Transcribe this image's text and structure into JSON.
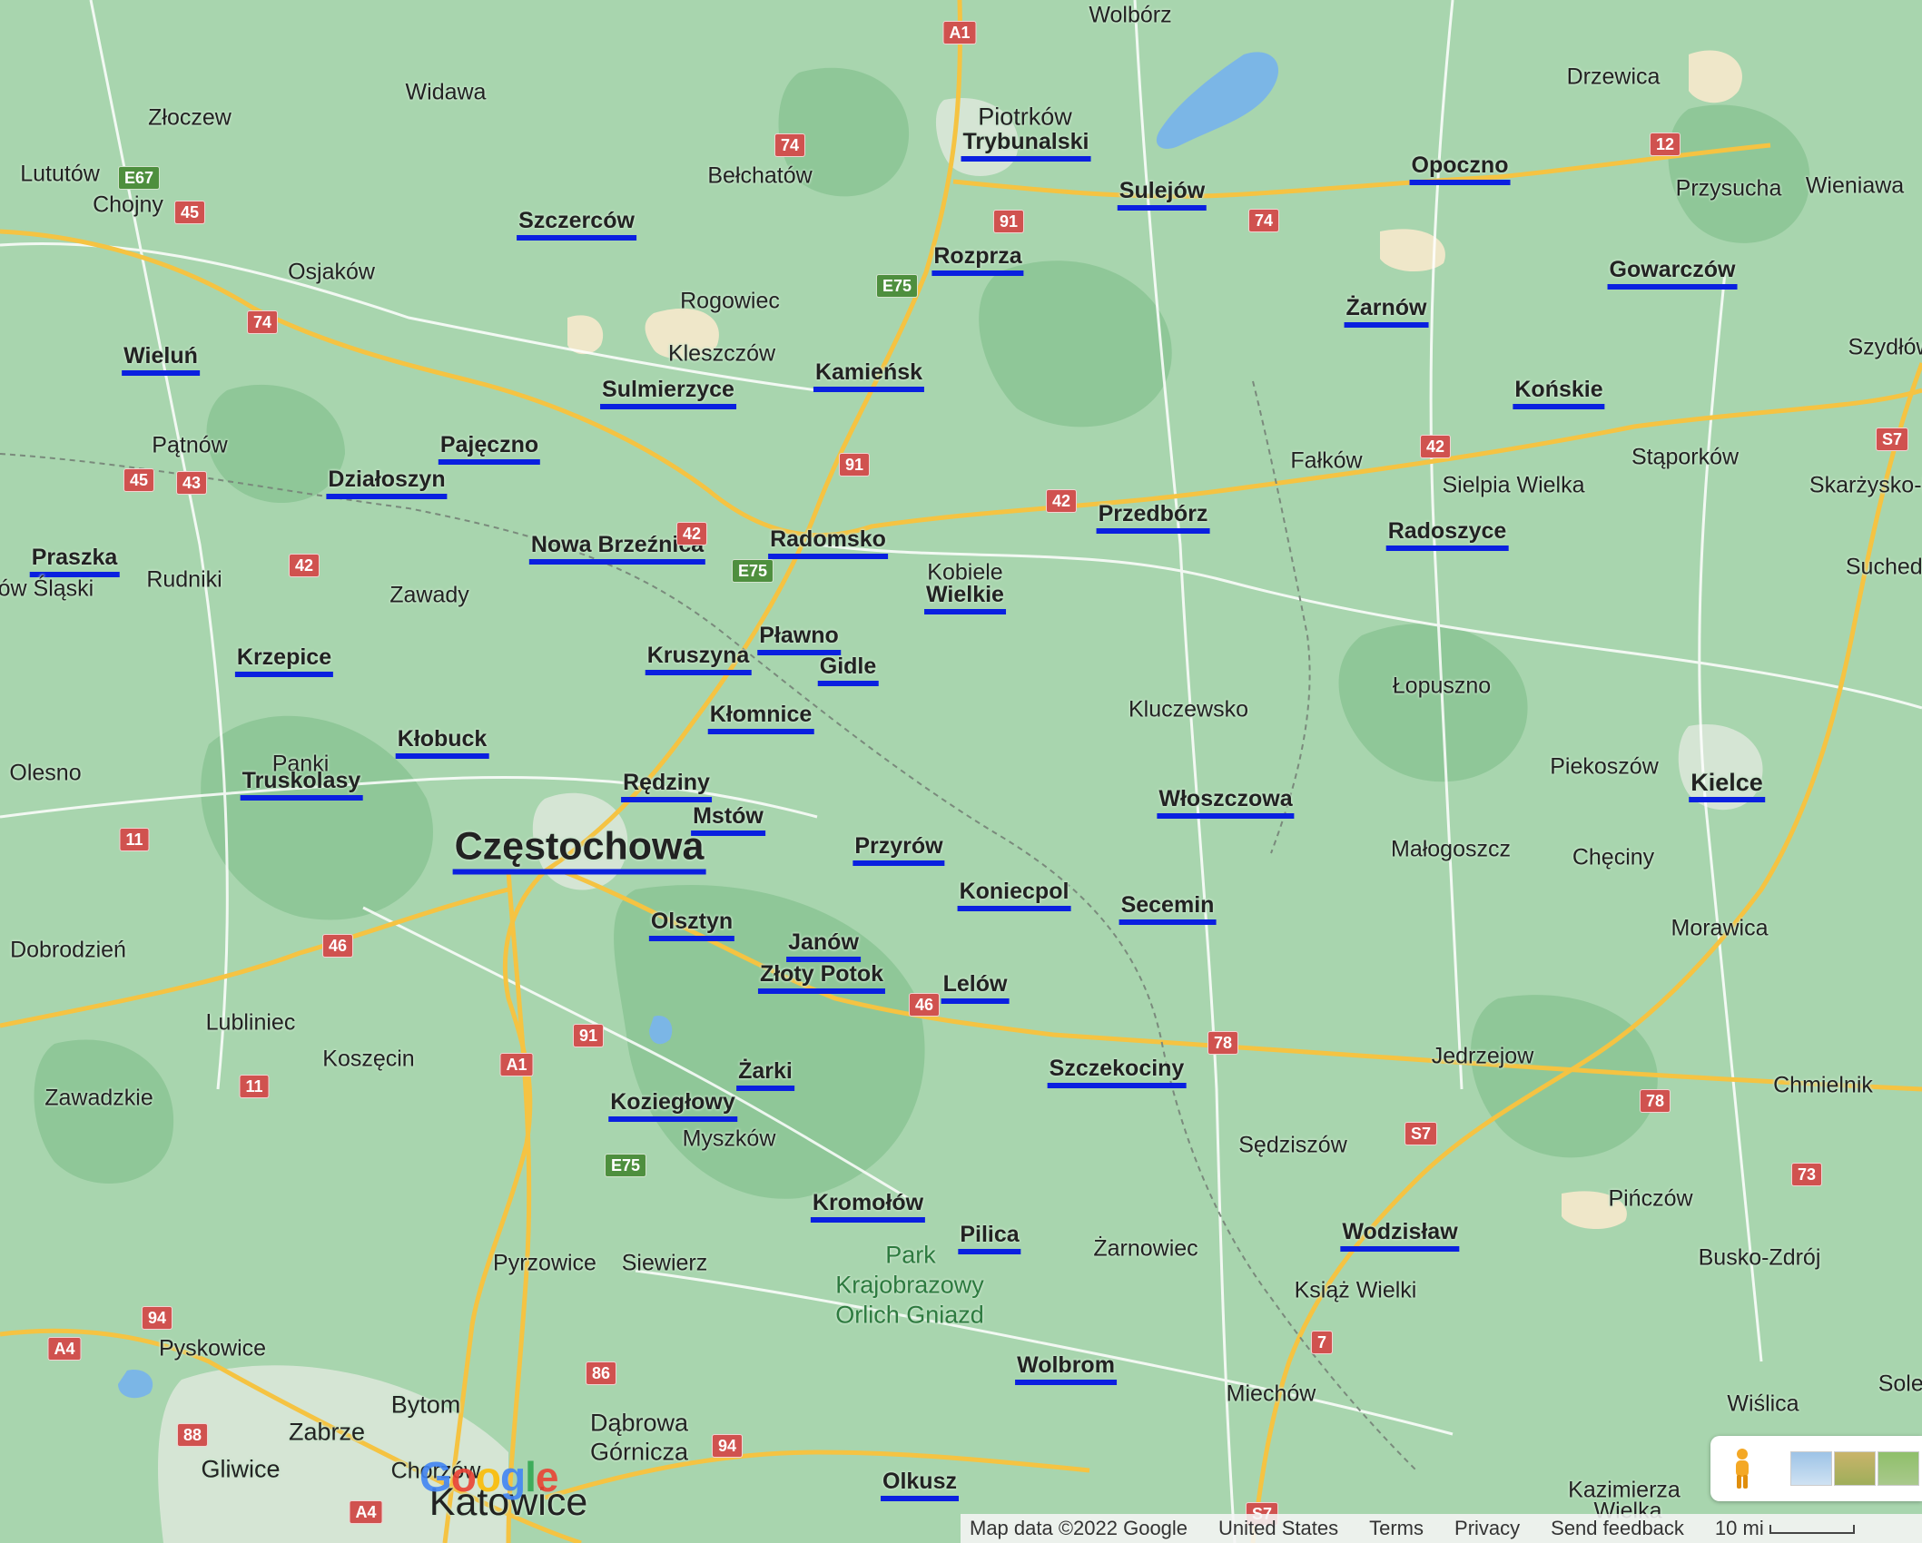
{
  "places": [
    {
      "name": "Wolbórz",
      "highlight": false
    },
    {
      "name": "Piotrków",
      "highlight": false,
      "size": "mid"
    },
    {
      "name": "Trybunalski",
      "highlight": true
    },
    {
      "name": "Drzewica",
      "highlight": false
    },
    {
      "name": "Widawa",
      "highlight": false
    },
    {
      "name": "Złoczew",
      "highlight": false
    },
    {
      "name": "Lututów",
      "highlight": false
    },
    {
      "name": "Chojny",
      "highlight": false
    },
    {
      "name": "Bełchatów",
      "highlight": false
    },
    {
      "name": "Szczerców",
      "highlight": true
    },
    {
      "name": "Sulejów",
      "highlight": true
    },
    {
      "name": "Opoczno",
      "highlight": true
    },
    {
      "name": "Przysucha",
      "highlight": false
    },
    {
      "name": "Wieniawa",
      "highlight": false
    },
    {
      "name": "Osjaków",
      "highlight": false
    },
    {
      "name": "Rozprza",
      "highlight": true
    },
    {
      "name": "Gowarczów",
      "highlight": true
    },
    {
      "name": "Rogowiec",
      "highlight": false
    },
    {
      "name": "Żarnów",
      "highlight": true
    },
    {
      "name": "Wieluń",
      "highlight": true
    },
    {
      "name": "Kleszczów",
      "highlight": false
    },
    {
      "name": "Kamieńsk",
      "highlight": true
    },
    {
      "name": "Szydłów",
      "highlight": false
    },
    {
      "name": "Sulmierzyce",
      "highlight": true
    },
    {
      "name": "Końskie",
      "highlight": true
    },
    {
      "name": "Pątnów",
      "highlight": false
    },
    {
      "name": "Pajęczno",
      "highlight": true
    },
    {
      "name": "Fałków",
      "highlight": false
    },
    {
      "name": "Stąporków",
      "highlight": false
    },
    {
      "name": "Działoszyn",
      "highlight": true
    },
    {
      "name": "Sielpia Wielka",
      "highlight": false
    },
    {
      "name": "Skarżysko-Ka",
      "highlight": false
    },
    {
      "name": "Przedbórz",
      "highlight": true
    },
    {
      "name": "Radoszyce",
      "highlight": true
    },
    {
      "name": "Nowa Brzeźnica",
      "highlight": true
    },
    {
      "name": "Radomsko",
      "highlight": true
    },
    {
      "name": "Praszka",
      "highlight": true
    },
    {
      "name": "Suchedni",
      "highlight": false
    },
    {
      "name": "Kobiele",
      "highlight": false
    },
    {
      "name": "Wielkie",
      "highlight": true
    },
    {
      "name": "rzów Śląski",
      "highlight": false
    },
    {
      "name": "Rudniki",
      "highlight": false
    },
    {
      "name": "Zawady",
      "highlight": false
    },
    {
      "name": "Pławno",
      "highlight": true
    },
    {
      "name": "Kruszyna",
      "highlight": true
    },
    {
      "name": "Krzepice",
      "highlight": true
    },
    {
      "name": "Gidle",
      "highlight": true
    },
    {
      "name": "Łopuszno",
      "highlight": false
    },
    {
      "name": "Kluczewsko",
      "highlight": false
    },
    {
      "name": "Kłomnice",
      "highlight": true
    },
    {
      "name": "Kłobuck",
      "highlight": true
    },
    {
      "name": "Panki",
      "highlight": false
    },
    {
      "name": "Piekoszów",
      "highlight": false
    },
    {
      "name": "Olesno",
      "highlight": false
    },
    {
      "name": "Kielce",
      "highlight": true,
      "size": "mid"
    },
    {
      "name": "Rędziny",
      "highlight": true
    },
    {
      "name": "Truskolasy",
      "highlight": true
    },
    {
      "name": "Włoszczowa",
      "highlight": true
    },
    {
      "name": "Mstów",
      "highlight": true
    },
    {
      "name": "Częstochowa",
      "highlight": true,
      "size": "big"
    },
    {
      "name": "Przyrów",
      "highlight": true
    },
    {
      "name": "Małogoszcz",
      "highlight": false
    },
    {
      "name": "Chęciny",
      "highlight": false
    },
    {
      "name": "Koniecpol",
      "highlight": true
    },
    {
      "name": "Secemin",
      "highlight": true
    },
    {
      "name": "Olsztyn",
      "highlight": true
    },
    {
      "name": "Morawica",
      "highlight": false
    },
    {
      "name": "Janów",
      "highlight": true
    },
    {
      "name": "Dobrodzień",
      "highlight": false
    },
    {
      "name": "Złoty Potok",
      "highlight": true
    },
    {
      "name": "Lelów",
      "highlight": true
    },
    {
      "name": "Lubliniec",
      "highlight": false
    },
    {
      "name": "Koszęcin",
      "highlight": false
    },
    {
      "name": "Jedrzejow",
      "highlight": false
    },
    {
      "name": "Szczekociny",
      "highlight": true
    },
    {
      "name": "Żarki",
      "highlight": true
    },
    {
      "name": "Chmielnik",
      "highlight": false
    },
    {
      "name": "Zawadzkie",
      "highlight": false
    },
    {
      "name": "Koziegłowy",
      "highlight": true
    },
    {
      "name": "Myszków",
      "highlight": false
    },
    {
      "name": "Sędziszów",
      "highlight": false
    },
    {
      "name": "Pińczów",
      "highlight": false
    },
    {
      "name": "Kromołów",
      "highlight": true
    },
    {
      "name": "Wodzisław",
      "highlight": true
    },
    {
      "name": "Pilica",
      "highlight": true
    },
    {
      "name": "Żarnowiec",
      "highlight": false
    },
    {
      "name": "Park",
      "highlight": false,
      "size": "park"
    },
    {
      "name": "Busko-Zdrój",
      "highlight": false
    },
    {
      "name": "Pyrzowice",
      "highlight": false
    },
    {
      "name": "Siewierz",
      "highlight": false
    },
    {
      "name": "Krajobrazowy",
      "highlight": false,
      "size": "park"
    },
    {
      "name": "Książ Wielki",
      "highlight": false
    },
    {
      "name": "Orlich Gniazd",
      "highlight": false,
      "size": "park"
    },
    {
      "name": "Pyskowice",
      "highlight": false
    },
    {
      "name": "Wolbrom",
      "highlight": true
    },
    {
      "name": "Miechów",
      "highlight": false
    },
    {
      "name": "Bytom",
      "highlight": false,
      "size": "mid"
    },
    {
      "name": "Wiślica",
      "highlight": false
    },
    {
      "name": "Solec",
      "highlight": false
    },
    {
      "name": "Dąbrowa",
      "highlight": false,
      "size": "mid"
    },
    {
      "name": "Zabrze",
      "highlight": false,
      "size": "mid"
    },
    {
      "name": "Górnicza",
      "highlight": false,
      "size": "mid"
    },
    {
      "name": "Gliwice",
      "highlight": false,
      "size": "mid"
    },
    {
      "name": "Chorzów",
      "highlight": false
    },
    {
      "name": "Olkusz",
      "highlight": true
    },
    {
      "name": "Kazimierza",
      "highlight": false
    },
    {
      "name": "Wielka",
      "highlight": false
    },
    {
      "name": "Katowice",
      "highlight": false,
      "size": "big"
    }
  ],
  "road_shields": [
    {
      "label": "A1",
      "color": "red"
    },
    {
      "label": "74",
      "color": "red"
    },
    {
      "label": "E67",
      "color": "green"
    },
    {
      "label": "45",
      "color": "red"
    },
    {
      "label": "12",
      "color": "red"
    },
    {
      "label": "91",
      "color": "red"
    },
    {
      "label": "74",
      "color": "red"
    },
    {
      "label": "E75",
      "color": "green"
    },
    {
      "label": "74",
      "color": "red"
    },
    {
      "label": "91",
      "color": "red"
    },
    {
      "label": "42",
      "color": "red"
    },
    {
      "label": "S7",
      "color": "red"
    },
    {
      "label": "45",
      "color": "red"
    },
    {
      "label": "43",
      "color": "red"
    },
    {
      "label": "42",
      "color": "red"
    },
    {
      "label": "42",
      "color": "red"
    },
    {
      "label": "E75",
      "color": "green"
    },
    {
      "label": "42",
      "color": "red"
    },
    {
      "label": "11",
      "color": "red"
    },
    {
      "label": "46",
      "color": "red"
    },
    {
      "label": "46",
      "color": "red"
    },
    {
      "label": "91",
      "color": "red"
    },
    {
      "label": "78",
      "color": "red"
    },
    {
      "label": "11",
      "color": "red"
    },
    {
      "label": "A1",
      "color": "red"
    },
    {
      "label": "78",
      "color": "red"
    },
    {
      "label": "S7",
      "color": "red"
    },
    {
      "label": "E75",
      "color": "green"
    },
    {
      "label": "73",
      "color": "red"
    },
    {
      "label": "94",
      "color": "red"
    },
    {
      "label": "A4",
      "color": "red"
    },
    {
      "label": "7",
      "color": "red"
    },
    {
      "label": "86",
      "color": "red"
    },
    {
      "label": "88",
      "color": "red"
    },
    {
      "label": "94",
      "color": "red"
    },
    {
      "label": "A4",
      "color": "red"
    },
    {
      "label": "S7",
      "color": "red"
    }
  ],
  "footer": {
    "map_data": "Map data ©2022 Google",
    "region": "United States",
    "terms": "Terms",
    "privacy": "Privacy",
    "feedback": "Send feedback",
    "scale": "10 mi"
  },
  "logo": "Google",
  "colors": {
    "land": "#a8d5ae",
    "forest": "#8cc596",
    "highway": "#f5c342",
    "road": "#ffffff",
    "highlight": "#0a20e0",
    "water": "#7bb6e6"
  }
}
